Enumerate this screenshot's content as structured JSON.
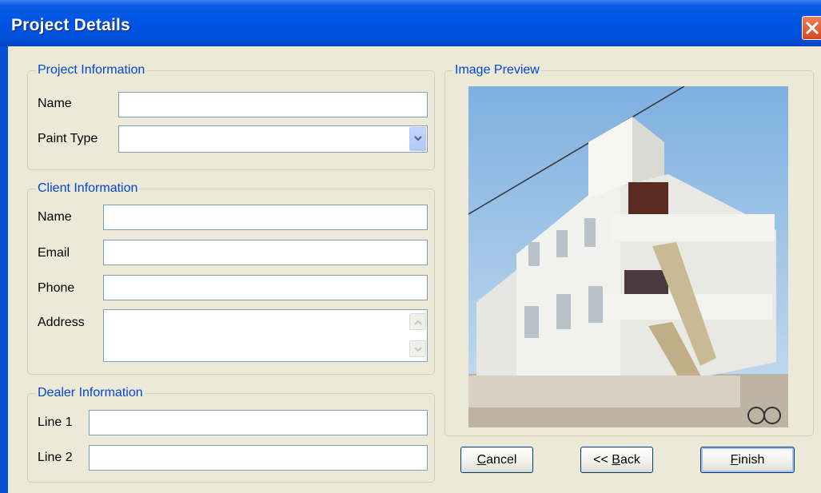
{
  "window": {
    "title": "Project Details",
    "close_icon": "close-icon"
  },
  "project_info": {
    "legend": "Project Information",
    "name_label": "Name",
    "name_value": "",
    "paint_type_label": "Paint Type",
    "paint_type_value": ""
  },
  "client_info": {
    "legend": "Client Information",
    "name_label": "Name",
    "name_value": "",
    "email_label": "Email",
    "email_value": "",
    "phone_label": "Phone",
    "phone_value": "",
    "address_label": "Address",
    "address_value": ""
  },
  "dealer_info": {
    "legend": "Dealer Information",
    "line1_label": "Line 1",
    "line1_value": "",
    "line2_label": "Line 2",
    "line2_value": ""
  },
  "image_preview": {
    "legend": "Image Preview"
  },
  "buttons": {
    "cancel_first": "C",
    "cancel_rest": "ancel",
    "back_prefix": "<< ",
    "back_first": "B",
    "back_rest": "ack",
    "finish_first": "F",
    "finish_rest": "inish"
  },
  "colors": {
    "accent": "#0046d5",
    "titlebar": "#0054e3",
    "dialog_bg": "#ece9d8"
  }
}
